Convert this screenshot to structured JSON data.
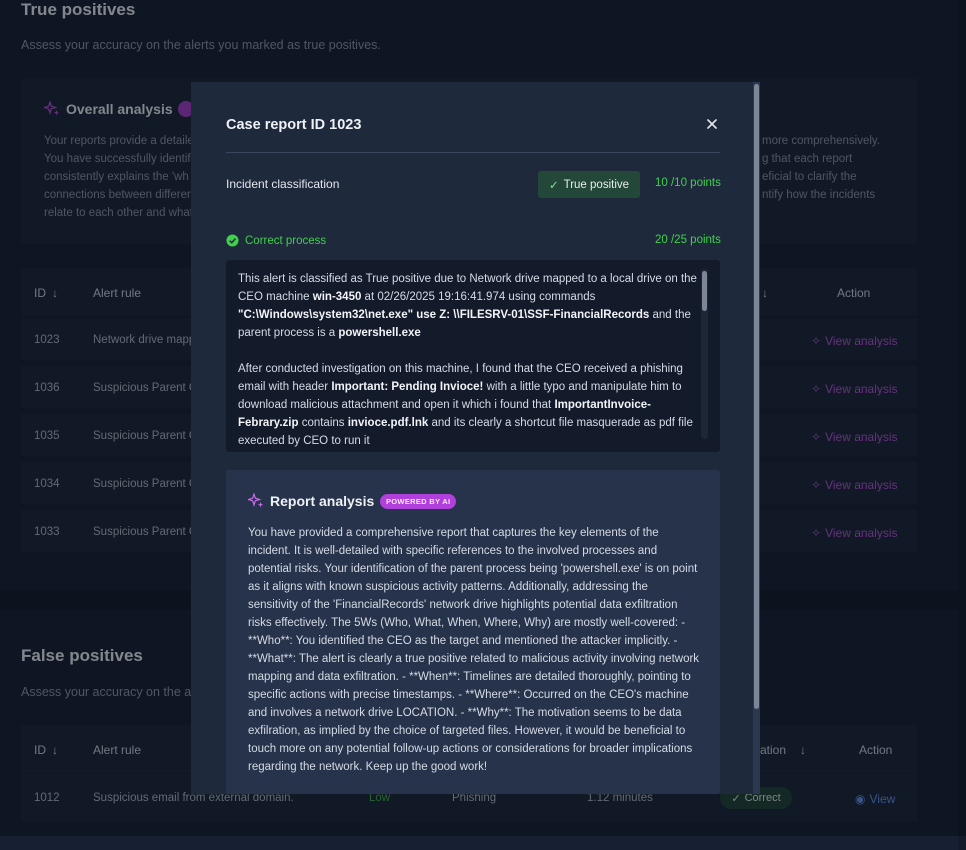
{
  "true_positives": {
    "title": "True positives",
    "subtitle": "Assess your accuracy on the alerts you marked as true positives.",
    "overall": {
      "title": "Overall analysis",
      "lines_left": [
        "Your reports provide a detaile",
        "You have successfully identifi",
        "consistently explains the 'wh",
        "connections between differen",
        "relate to each other and what"
      ],
      "lines_right": [
        "more comprehensively.",
        "g that each report",
        "eficial to clarify the",
        "ntify how the incidents"
      ]
    },
    "table": {
      "headers": {
        "id": "ID",
        "alert_rule": "Alert rule",
        "action": "Action"
      },
      "rows": [
        {
          "id": "1023",
          "rule": "Network drive mapp",
          "action": "View analysis"
        },
        {
          "id": "1036",
          "rule": "Suspicious Parent C",
          "action": "View analysis"
        },
        {
          "id": "1035",
          "rule": "Suspicious Parent C",
          "action": "View analysis"
        },
        {
          "id": "1034",
          "rule": "Suspicious Parent C",
          "action": "View analysis"
        },
        {
          "id": "1033",
          "rule": "Suspicious Parent C",
          "action": "View analysis"
        }
      ]
    }
  },
  "false_positives": {
    "title": "False positives",
    "subtitle": "Assess your accuracy on the al",
    "table": {
      "headers": {
        "id": "ID",
        "alert_rule": "Alert rule",
        "classification": "ation",
        "action": "Action"
      },
      "row": {
        "id": "1012",
        "rule": "Suspicious email from external domain.",
        "severity": "Low",
        "type": "Phishing",
        "duration": "1.12 minutes",
        "status": "Correct",
        "action": "View"
      }
    }
  },
  "modal": {
    "title": "Case report ID 1023",
    "incident_label": "Incident classification",
    "classification_badge": "True positive",
    "classification_points": "10 /10 points",
    "process_label": "Correct process",
    "process_points": "20 /25 points",
    "report": {
      "p1_a": "This alert is classified as True positive due to Network drive mapped to a local drive on the CEO machine ",
      "p1_host": "win-3450",
      "p1_b": " at 02/26/2025 19:16:41.974 using commands ",
      "p1_cmd": "\"C:\\Windows\\system32\\net.exe\" use Z: \\\\FILESRV-01\\SSF-FinancialRecords",
      "p1_c": " and the parent process is a ",
      "p1_parent": "powershell.exe",
      "p2_a": "After conducted investigation on this machine, I found that the CEO received a phishing email with header ",
      "p2_header": "Important: Pending Invioce!",
      "p2_b": " with a little typo and manipulate him to download malicious attachment and open it which i found that ",
      "p2_zip": "ImportantInvoice-Febrary.zip",
      "p2_c": " contains ",
      "p2_lnk": "invioce.pdf.lnk",
      "p2_d": " and its clearly a shortcut file masquerade as pdf file executed by CEO to run it"
    },
    "analysis": {
      "title": "Report analysis",
      "badge": "POWERED BY AI",
      "text": "You have provided a comprehensive report that captures the key elements of the incident. It is well-detailed with specific references to the involved processes and potential risks. Your identification of the parent process being 'powershell.exe' is on point as it aligns with known suspicious activity patterns. Additionally, addressing the sensitivity of the 'FinancialRecords' network drive highlights potential data exfiltration risks effectively. The 5Ws (Who, What, When, Where, Why) are mostly well-covered: - **Who**: You identified the CEO as the target and mentioned the attacker implicitly. - **What**: The alert is clearly a true positive related to malicious activity involving network mapping and data exfiltration. - **When**: Timelines are detailed thoroughly, pointing to specific actions with precise timestamps. - **Where**: Occurred on the CEO's machine and involves a network drive LOCATION. - **Why**: The motivation seems to be data exfilration, as implied by the choice of targeted files. However, it would be beneficial to touch more on any potential follow-up actions or considerations for broader implications regarding the network. Keep up the good work!"
    }
  },
  "colors": {
    "accent_purple": "#b151d6",
    "success_green": "#3fd14c",
    "link_blue": "#5d8ee8"
  }
}
